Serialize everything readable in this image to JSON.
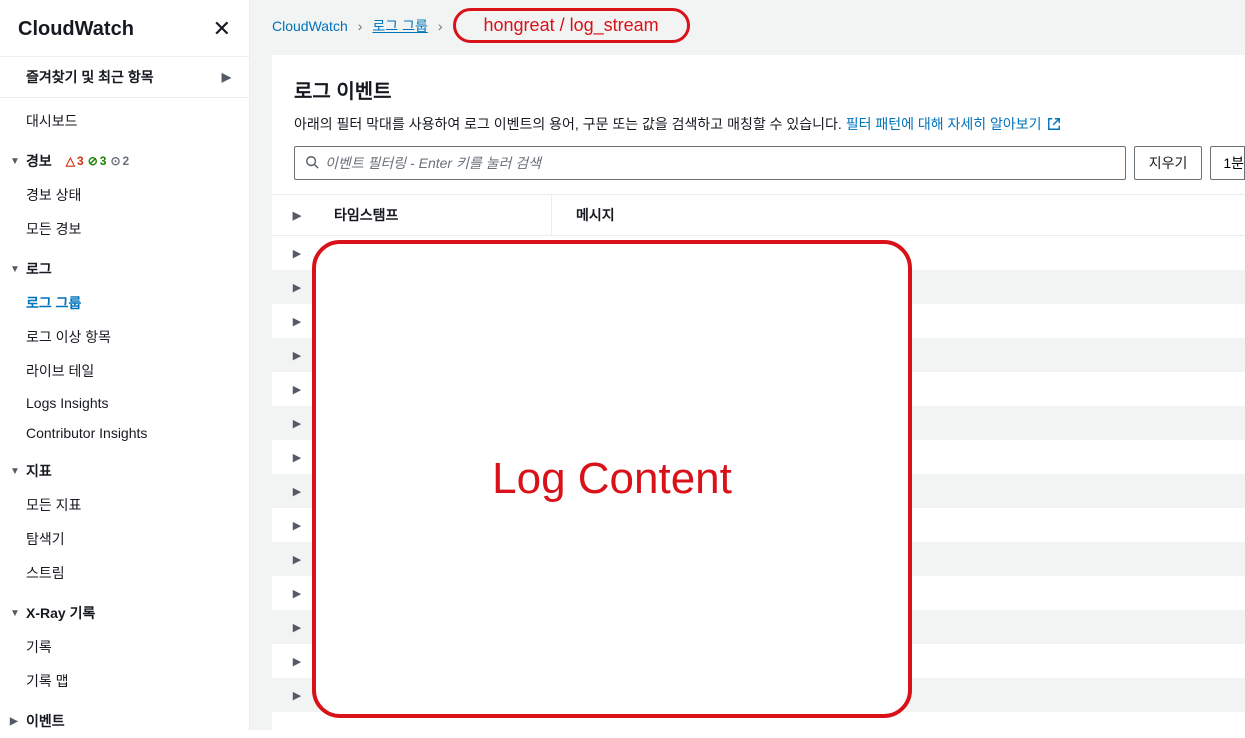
{
  "sidebar": {
    "title": "CloudWatch",
    "favorites": "즐겨찾기 및 최근 항목",
    "dashboard": "대시보드",
    "alarms": {
      "label": "경보",
      "red_count": "3",
      "green_count": "3",
      "grey_count": "2",
      "items": [
        "경보 상태",
        "모든 경보"
      ]
    },
    "logs": {
      "label": "로그",
      "items": [
        "로그 그룹",
        "로그 이상 항목",
        "라이브 테일",
        "Logs Insights",
        "Contributor Insights"
      ],
      "active_index": 0
    },
    "metrics": {
      "label": "지표",
      "items": [
        "모든 지표",
        "탐색기",
        "스트림"
      ]
    },
    "xray": {
      "label": "X-Ray 기록",
      "items": [
        "기록",
        "기록 맵"
      ]
    },
    "events": {
      "label": "이벤트"
    }
  },
  "breadcrumb": {
    "a": "CloudWatch",
    "b": "로그 그룹",
    "highlight": "hongreat / log_stream"
  },
  "card": {
    "title": "로그 이벤트",
    "desc_prefix": "아래의 필터 막대를 사용하여 로그 이벤트의 용어, 구문 또는 값을 검색하고 매칭할 수 있습니다. ",
    "desc_link": "필터 패턴에 대해 자세히 알아보기",
    "search_placeholder": "이벤트 필터링 - Enter 키를 눌러 검색",
    "clear_btn": "지우기",
    "range_btn": "1분",
    "col_ts": "타임스탬프",
    "col_msg": "메시지"
  },
  "overlay": {
    "label": "Log Content"
  },
  "rows": [
    {
      "ts": "",
      "msg": ""
    },
    {
      "ts": "",
      "msg": ""
    },
    {
      "ts": "",
      "msg": ""
    },
    {
      "ts": "",
      "msg": ""
    },
    {
      "ts": "",
      "msg": ""
    },
    {
      "ts": "",
      "msg": ""
    },
    {
      "ts": "",
      "msg": ""
    },
    {
      "ts": "",
      "msg": ""
    },
    {
      "ts": "",
      "msg": ""
    },
    {
      "ts": "",
      "msg": ""
    },
    {
      "ts": "",
      "msg": ""
    },
    {
      "ts": "",
      "msg": ""
    },
    {
      "ts": "",
      "msg": ""
    },
    {
      "ts": "",
      "msg": ""
    }
  ]
}
